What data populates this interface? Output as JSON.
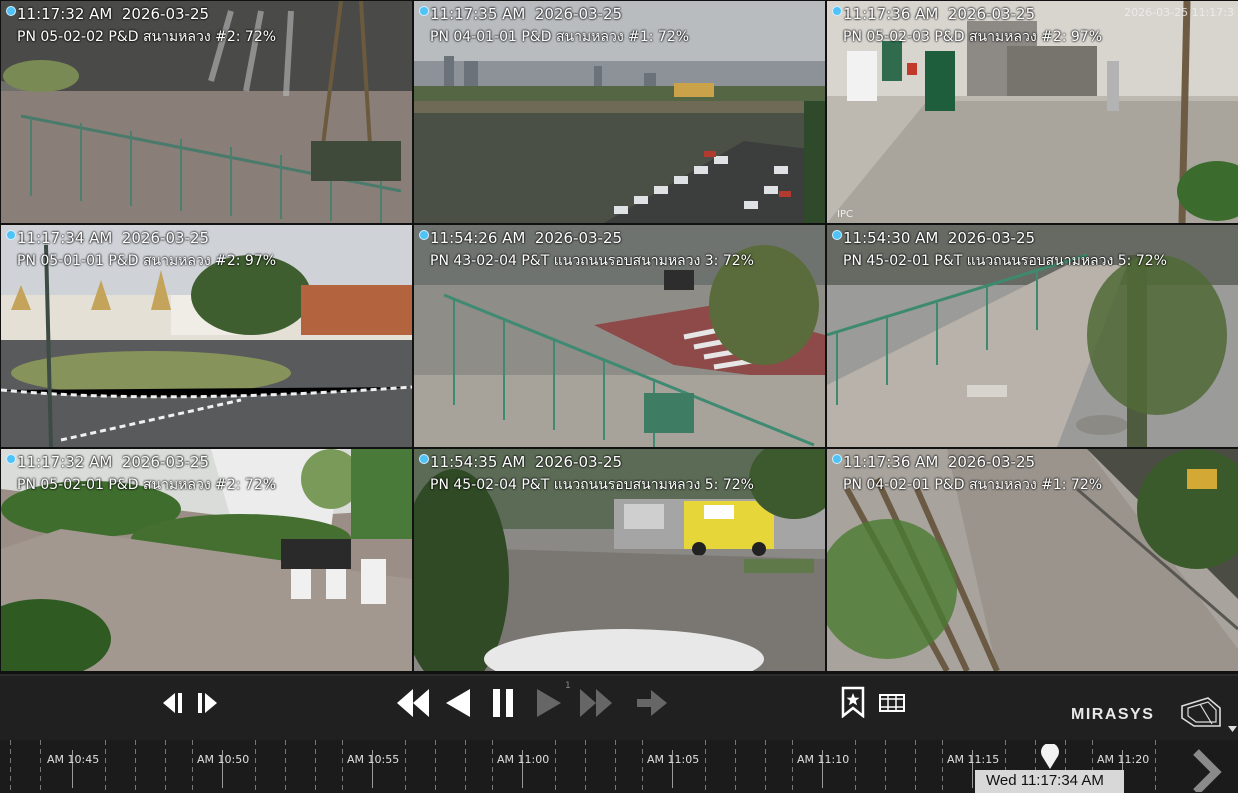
{
  "cameras": [
    {
      "timestamp": "11:17:32 AM  2026-03-25",
      "label": "PN 05-02-02 P&D สนามหลวง #2: 72%"
    },
    {
      "timestamp": "11:17:35 AM  2026-03-25",
      "label": "PN 04-01-01 P&D สนามหลวง #1: 72%"
    },
    {
      "timestamp": "11:17:36 AM  2026-03-25",
      "label": "PN 05-02-03 P&D สนามหลวง #2: 97%",
      "overlay_right": "2026-03-25 11:17:3",
      "overlay_bottom": "IPC"
    },
    {
      "timestamp": "11:17:34 AM  2026-03-25",
      "label": "PN 05-01-01 P&D สนามหลวง #2: 97%"
    },
    {
      "timestamp": "11:54:26 AM  2026-03-25",
      "label": "PN 43-02-04 P&T แนวถนนรอบสนามหลวง 3: 72%"
    },
    {
      "timestamp": "11:54:30 AM  2026-03-25",
      "label": "PN 45-02-01 P&T แนวถนนรอบสนามหลวง 5: 72%"
    },
    {
      "timestamp": "11:17:32 AM  2026-03-25",
      "label": "PN 05-02-01 P&D สนามหลวง #2: 72%"
    },
    {
      "timestamp": "11:54:35 AM  2026-03-25",
      "label": "PN 45-02-04 P&T แนวถนนรอบสนามหลวง 5: 72%"
    },
    {
      "timestamp": "11:17:36 AM  2026-03-25",
      "label": "PN 04-02-01 P&D สนามหลวง #1: 72%"
    }
  ],
  "controls": {
    "speed_label": "1",
    "brand": "MIRASYS",
    "icons": [
      "step-back-frame-icon",
      "step-forward-frame-icon",
      "rewind-icon",
      "play-reverse-icon",
      "pause-icon",
      "play-icon",
      "fast-forward-icon",
      "go-live-icon",
      "bookmark-icon",
      "film-icon",
      "mirasys-logo-icon",
      "dropdown-icon"
    ]
  },
  "timeline": {
    "labels": [
      "AM 10:45",
      "AM 10:50",
      "AM 10:55",
      "AM 11:00",
      "AM 11:05",
      "AM 11:10",
      "AM 11:15",
      "AM 11:20"
    ],
    "cursor_time": "Wed 11:17:34 AM"
  }
}
